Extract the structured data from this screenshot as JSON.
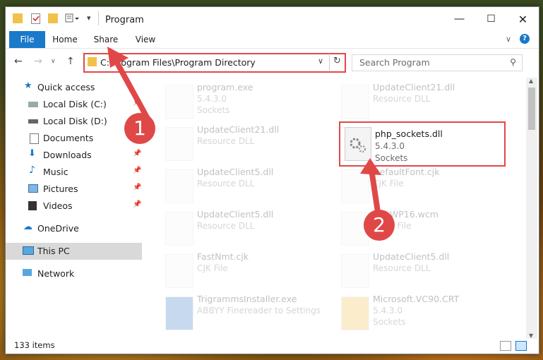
{
  "window": {
    "title": "Program"
  },
  "ribbon": {
    "tabs": [
      "File",
      "Home",
      "Share",
      "View"
    ]
  },
  "address": {
    "path": "C:\\Program Files\\Program Directory",
    "search_placeholder": "Search Program"
  },
  "sidebar": {
    "items": [
      {
        "label": "Quick access",
        "pinned": false
      },
      {
        "label": "Local Disk (C:)",
        "pinned": true
      },
      {
        "label": "Local Disk (D:)",
        "pinned": false
      },
      {
        "label": "Documents",
        "pinned": false
      },
      {
        "label": "Downloads",
        "pinned": true
      },
      {
        "label": "Music",
        "pinned": true
      },
      {
        "label": "Pictures",
        "pinned": true
      },
      {
        "label": "Videos",
        "pinned": true
      },
      {
        "label": "OneDrive",
        "pinned": false
      },
      {
        "label": "This PC",
        "pinned": false
      },
      {
        "label": "Network",
        "pinned": false
      }
    ]
  },
  "files": [
    {
      "name": "program.exe",
      "l1": "5.4.3.0",
      "l2": "Sockets"
    },
    {
      "name": "UpdateClient21.dll",
      "l1": "Resource DLL",
      "l2": ""
    },
    {
      "name": "UpdateClient21.dll",
      "l1": "Resource DLL",
      "l2": ""
    },
    {
      "name": "php_sockets.dll",
      "l1": "5.4.3.0",
      "l2": "Sockets"
    },
    {
      "name": "UpdateClient5.dll",
      "l1": "Resource DLL",
      "l2": ""
    },
    {
      "name": "DefaultFont.cjk",
      "l1": "CJK File",
      "l2": ""
    },
    {
      "name": "UpdateClient5.dll",
      "l1": "Resource DLL",
      "l2": ""
    },
    {
      "name": "AuxWP16.wcm",
      "l1": "WCM File",
      "l2": ""
    },
    {
      "name": "FastNmt.cjk",
      "l1": "CJK File",
      "l2": ""
    },
    {
      "name": "UpdateClient5.dll",
      "l1": "Resource DLL",
      "l2": ""
    },
    {
      "name": "TrigrammsInstaller.exe",
      "l1": "ABBYY Finereader to Settings",
      "l2": ""
    },
    {
      "name": "Microsoft.VC90.CRT",
      "l1": "5.4.3.0",
      "l2": "Sockets"
    }
  ],
  "status": {
    "count": "133 items"
  },
  "annotations": {
    "step1": "1",
    "step2": "2"
  },
  "colors": {
    "accent": "#1979ca",
    "highlight": "#e04848"
  }
}
